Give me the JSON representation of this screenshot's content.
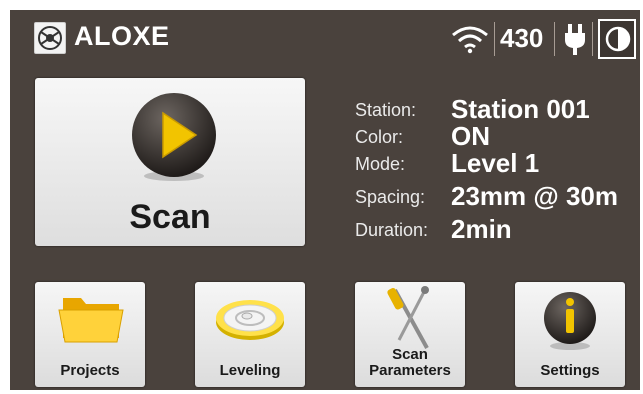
{
  "header": {
    "brand": "ALOXE",
    "count": "430",
    "icons": [
      "logo-icon",
      "wifi-icon",
      "power-plug-icon",
      "contrast-icon"
    ]
  },
  "scan": {
    "label": "Scan",
    "icon": "play-icon"
  },
  "info": [
    {
      "key": "Station:",
      "value": "Station 001"
    },
    {
      "key": "Color:",
      "value": "ON"
    },
    {
      "key": "Mode:",
      "value": "Level 1"
    },
    {
      "key": "Spacing:",
      "value": "23mm @ 30m"
    },
    {
      "key": "Duration:",
      "value": "2min"
    }
  ],
  "tiles": [
    {
      "label": "Projects",
      "icon": "folder-icon"
    },
    {
      "label": "Leveling",
      "icon": "level-icon"
    },
    {
      "label_line1": "Scan",
      "label_line2": "Parameters",
      "icon": "tools-icon"
    },
    {
      "label": "Settings",
      "icon": "info-icon"
    }
  ],
  "colors": {
    "background": "#4a423d",
    "accent": "#f2c400",
    "tile": "#ececec"
  }
}
